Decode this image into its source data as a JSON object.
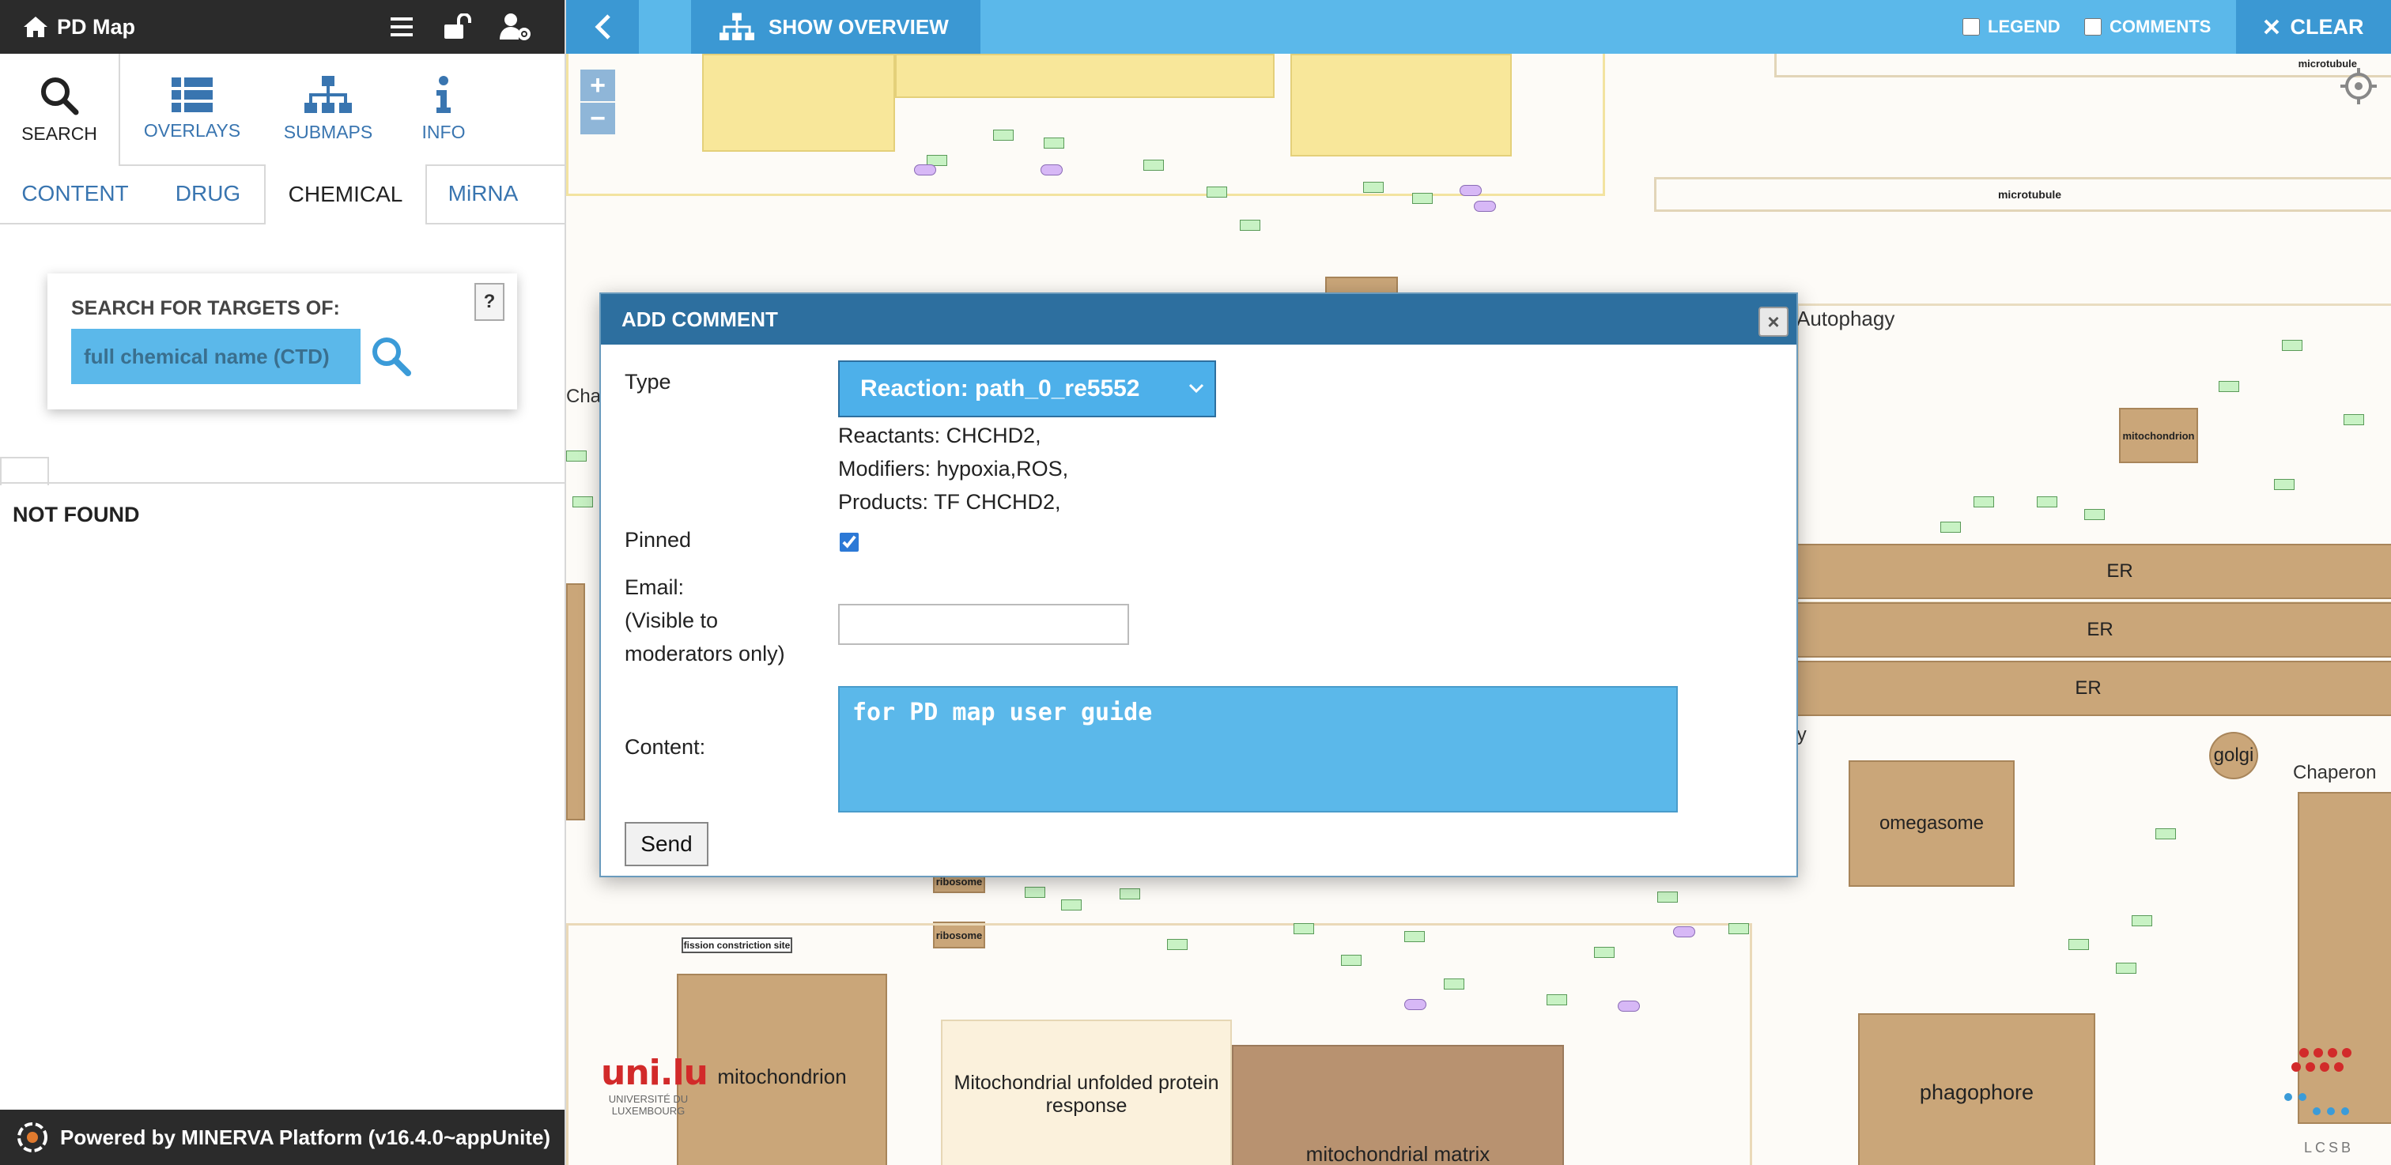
{
  "app": {
    "title": "PD Map"
  },
  "topbar_icons": [
    "menu-icon",
    "unlock-icon",
    "user-settings-icon"
  ],
  "main_nav": [
    {
      "label": "SEARCH",
      "icon": "search-icon",
      "active": true
    },
    {
      "label": "OVERLAYS",
      "icon": "list-icon"
    },
    {
      "label": "SUBMAPS",
      "icon": "sitemap-icon"
    },
    {
      "label": "INFO",
      "icon": "info-icon"
    }
  ],
  "tabs": [
    {
      "label": "CONTENT"
    },
    {
      "label": "DRUG"
    },
    {
      "label": "CHEMICAL",
      "active": true
    },
    {
      "label": "MiRNA"
    }
  ],
  "search": {
    "label": "SEARCH FOR TARGETS OF:",
    "placeholder": "full chemical name (CTD)",
    "help": "?"
  },
  "result": {
    "status": "NOT FOUND"
  },
  "footer": {
    "text": "Powered by MINERVA Platform (v16.4.0~appUnite)"
  },
  "map_toolbar": {
    "overview": "SHOW OVERVIEW",
    "legend": "LEGEND",
    "comments": "COMMENTS",
    "clear": "CLEAR"
  },
  "zoom": {
    "in": "+",
    "out": "−"
  },
  "map_labels": {
    "microtubule1": "microtubule",
    "microtubule2": "microtubule",
    "autophagy": "Autophagy",
    "mitochondrion_small": "mitochondrion",
    "er1": "ER",
    "er2": "ER",
    "er3": "ER",
    "golgi": "golgi",
    "chaperon": "Chaperon",
    "omegasome": "omegasome",
    "ribosome1": "ribosome",
    "ribosome2": "ribosome",
    "fission": "fission constriction site",
    "mitochondrion": "mitochondrion",
    "mito_unfolded": "Mitochondrial unfolded protein response",
    "mito_matrix": "mitochondrial matrix",
    "phagophore": "phagophore",
    "cha": "Cha",
    "agy": "agy",
    "uni_logo": "uni.lu",
    "uni_name1": "UNIVERSITÉ DU",
    "uni_name2": "LUXEMBOURG",
    "lcsb": "LCSB"
  },
  "dialog": {
    "title": "ADD COMMENT",
    "close": "×",
    "type_label": "Type",
    "type_value": "Reaction: path_0_re5552",
    "reactants": "Reactants: CHCHD2,",
    "modifiers": "Modifiers: hypoxia,ROS,",
    "products": "Products: TF CHCHD2,",
    "pinned_label": "Pinned",
    "pinned": true,
    "email_label1": "Email:",
    "email_label2": "(Visible to",
    "email_label3": "moderators only)",
    "email_value": "",
    "content_label": "Content:",
    "content_value": "for PD map user guide",
    "send": "Send"
  }
}
